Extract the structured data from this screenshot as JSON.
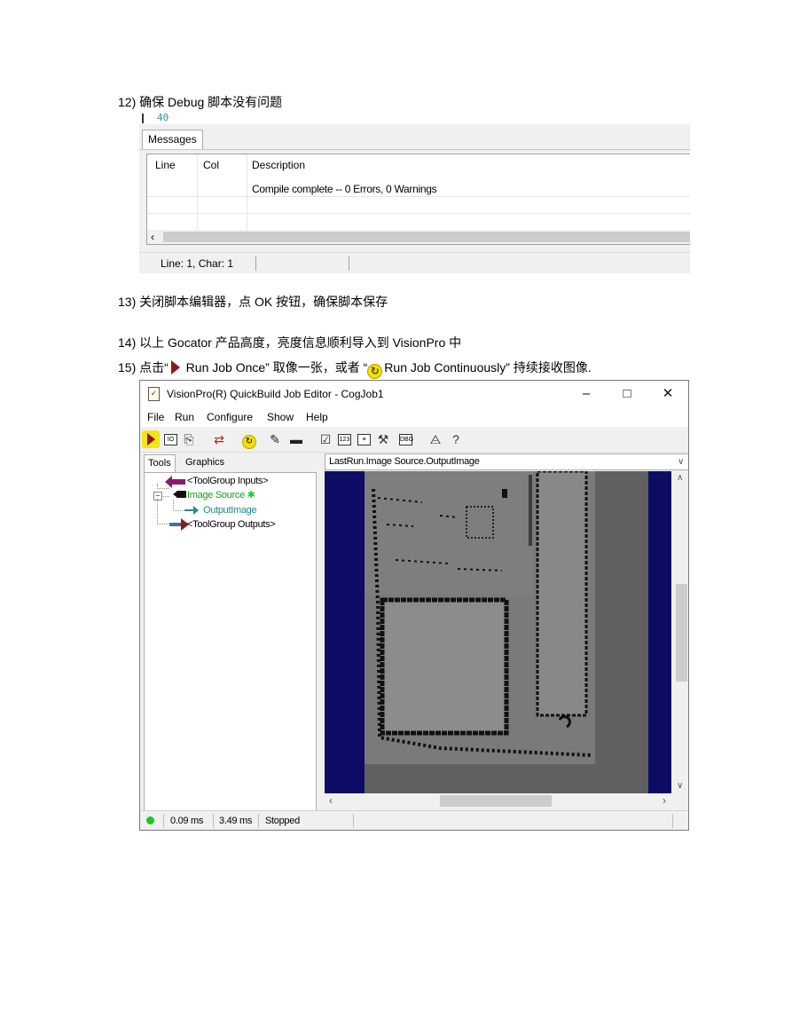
{
  "steps": {
    "s12": "12) 确保 Debug 脚本没有问题",
    "s13": "13) 关闭脚本编辑器，点 OK  按钮，确保脚本保存",
    "s14": "14) 以上 Gocator 产品高度，亮度信息顺利导入到 VisionPro 中",
    "s15_prefix": "15) 点击“",
    "s15_run_once": " Run Job Once”  取像一张，或者 “",
    "s15_run_cont": "Run Job Continuously”  持续接收图像."
  },
  "editor": {
    "line_number": "40",
    "tab_messages": "Messages",
    "columns": [
      "Line",
      "Col",
      "Description"
    ],
    "message": "Compile complete -- 0 Errors, 0 Warnings",
    "status": "Line: 1, Char: 1"
  },
  "quickbuild": {
    "title": "VisionPro(R) QuickBuild Job Editor - CogJob1",
    "menu": [
      "File",
      "Run",
      "Configure",
      "Show",
      "Help"
    ],
    "tabs": [
      "Tools",
      "Graphics"
    ],
    "tree": {
      "inputs": "<ToolGroup Inputs>",
      "image_source": "Image Source",
      "output_image": "OutputImage",
      "outputs": "<ToolGroup Outputs>"
    },
    "image_selector": "LastRun.Image Source.OutputImage",
    "status": {
      "time1": "0.09 ms",
      "time2": "3.49 ms",
      "state": "Stopped"
    },
    "colors": {
      "run_highlight": "#f4e41a",
      "image_bg": "#0c0c64",
      "ok_dot": "#22c322"
    },
    "icons": [
      "run-once-icon",
      "run-continuous-icon",
      "image-source-camera-icon"
    ]
  }
}
